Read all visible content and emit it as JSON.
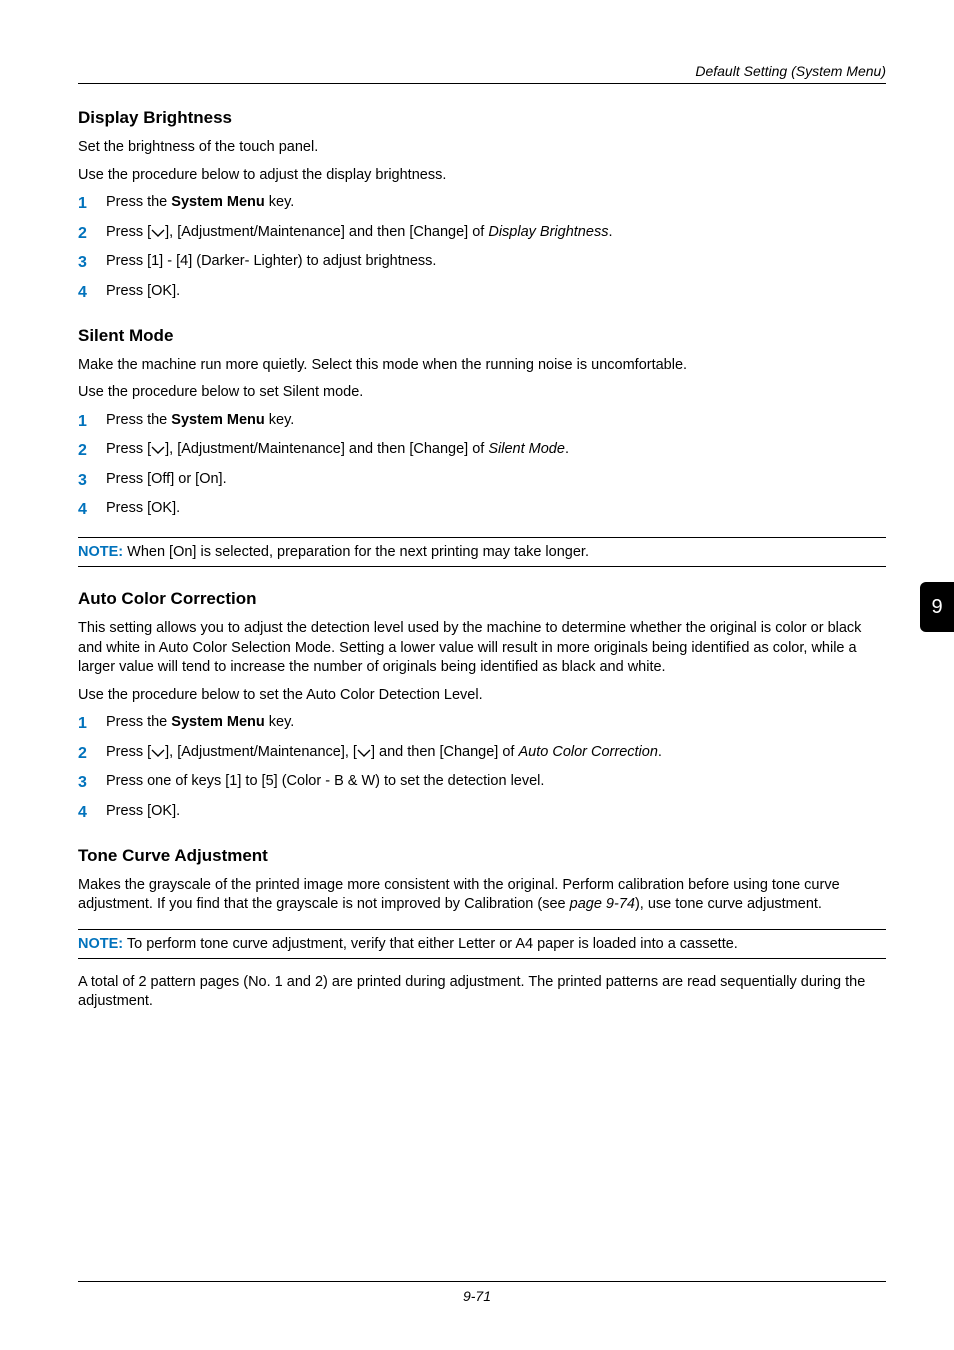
{
  "breadcrumb": "Default Setting (System Menu)",
  "side_tab": "9",
  "page_number": "9-71",
  "sections": {
    "display_brightness": {
      "heading": "Display Brightness",
      "p1": "Set the brightness of the touch panel.",
      "p2": "Use the procedure below to adjust the display brightness.",
      "steps": {
        "n1": "1",
        "s1a": "Press the ",
        "s1b": "System Menu",
        "s1c": " key.",
        "n2": "2",
        "s2a": "Press [",
        "s2b": "], [Adjustment/Maintenance] and then [Change] of ",
        "s2c": "Display Brightness",
        "s2d": ".",
        "n3": "3",
        "s3": "Press [1] - [4] (Darker- Lighter) to adjust brightness.",
        "n4": "4",
        "s4": "Press [OK]."
      }
    },
    "silent_mode": {
      "heading": "Silent Mode",
      "p1": "Make the machine run more quietly. Select this mode when the running noise is uncomfortable.",
      "p2": "Use the procedure below to set Silent mode.",
      "steps": {
        "n1": "1",
        "s1a": "Press the ",
        "s1b": "System Menu",
        "s1c": " key.",
        "n2": "2",
        "s2a": "Press [",
        "s2b": "], [Adjustment/Maintenance] and then [Change] of ",
        "s2c": "Silent Mode",
        "s2d": ".",
        "n3": "3",
        "s3": "Press [Off] or [On].",
        "n4": "4",
        "s4": "Press [OK]."
      },
      "note_label": "NOTE:",
      "note_body": " When [On] is selected, preparation for the next printing may take longer."
    },
    "auto_color": {
      "heading": "Auto Color Correction",
      "p1": "This setting allows you to adjust the detection level used by the machine to determine whether the original is color or black and white in Auto Color Selection Mode. Setting a lower value will result in more originals being identified as color, while a larger value will tend to increase the number of originals being identified as black and white.",
      "p2": "Use the procedure below to set the Auto Color Detection Level.",
      "steps": {
        "n1": "1",
        "s1a": "Press the ",
        "s1b": "System Menu",
        "s1c": " key.",
        "n2": "2",
        "s2a": "Press [",
        "s2b": "], [Adjustment/Maintenance], [",
        "s2c": "] and then [Change] of ",
        "s2d": "Auto Color Correction",
        "s2e": ".",
        "n3": "3",
        "s3": "Press one of keys [1] to [5] (Color - B & W) to set the detection level.",
        "n4": "4",
        "s4": "Press [OK]."
      }
    },
    "tone_curve": {
      "heading": "Tone Curve Adjustment",
      "p1a": "Makes the grayscale of the printed image more consistent with the original. Perform calibration before using tone curve adjustment. If you find that the grayscale is not improved by Calibration (see ",
      "p1b": "page 9-74",
      "p1c": "), use tone curve adjustment.",
      "note_label": "NOTE:",
      "note_body": " To perform tone curve adjustment, verify that either Letter or A4 paper is loaded into a cassette.",
      "p2": "A total of 2 pattern pages (No. 1 and 2) are printed during adjustment. The printed patterns are read sequentially during the adjustment."
    }
  }
}
